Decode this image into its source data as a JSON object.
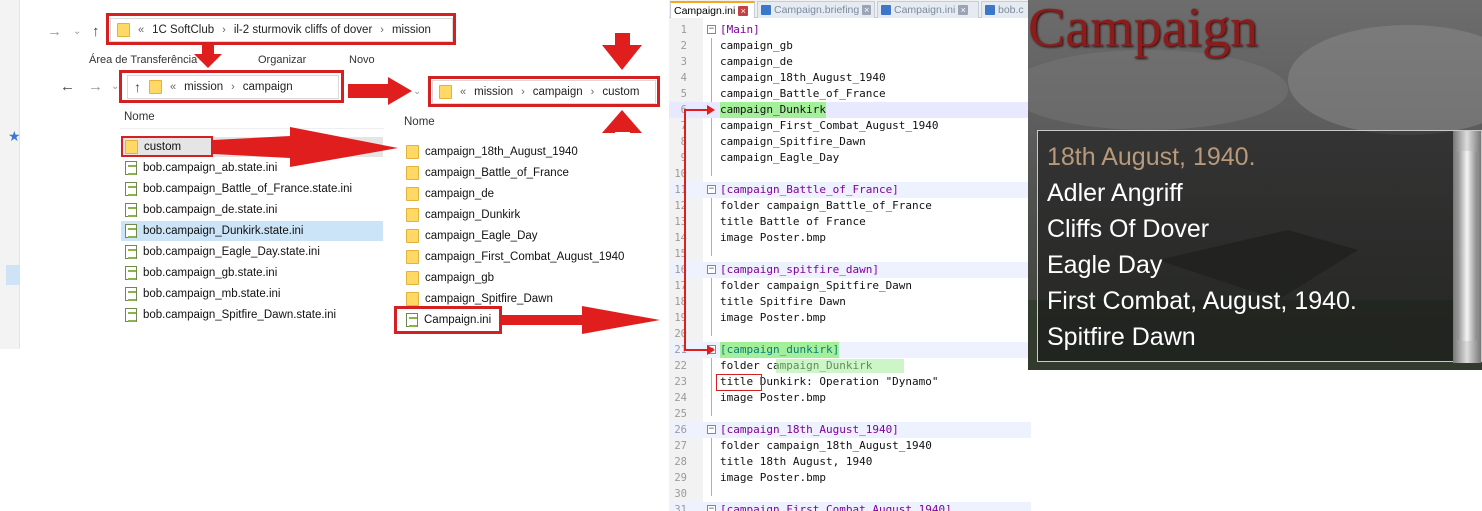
{
  "explorer": {
    "address1": {
      "seg0": "«",
      "seg1": "1C SoftClub",
      "seg2": "il-2 sturmovik cliffs of dover",
      "seg3": "mission"
    },
    "address2": {
      "seg0": "«",
      "seg1": "mission",
      "seg2": "campaign"
    },
    "address3": {
      "seg0": "«",
      "seg1": "mission",
      "seg2": "campaign",
      "seg3": "custom"
    },
    "ribbon": {
      "clipboard": "Área de Transferência",
      "organize": "Organizar",
      "new": "Novo"
    },
    "column_name": "Nome",
    "left_files": [
      "custom",
      "bob.campaign_ab.state.ini",
      "bob.campaign_Battle_of_France.state.ini",
      "bob.campaign_de.state.ini",
      "bob.campaign_Dunkirk.state.ini",
      "bob.campaign_Eagle_Day.state.ini",
      "bob.campaign_gb.state.ini",
      "bob.campaign_mb.state.ini",
      "bob.campaign_Spitfire_Dawn.state.ini"
    ],
    "right_files": [
      "campaign_18th_August_1940",
      "campaign_Battle_of_France",
      "campaign_de",
      "campaign_Dunkirk",
      "campaign_Eagle_Day",
      "campaign_First_Combat_August_1940",
      "campaign_gb",
      "campaign_Spitfire_Dawn",
      "Campaign.ini"
    ]
  },
  "editor": {
    "tabs": [
      "Campaign.ini",
      "Campaign.briefing",
      "Campaign.ini",
      "bob.c"
    ],
    "lines": [
      {
        "n": "1",
        "t": "[Main]"
      },
      {
        "n": "2",
        "t": "campaign_gb"
      },
      {
        "n": "3",
        "t": "campaign_de"
      },
      {
        "n": "4",
        "t": "campaign_18th_August_1940"
      },
      {
        "n": "5",
        "t": "campaign_Battle_of_France"
      },
      {
        "n": "6",
        "t": "campaign_Dunkirk"
      },
      {
        "n": "7",
        "t": "campaign_First_Combat_August_1940"
      },
      {
        "n": "8",
        "t": "campaign_Spitfire_Dawn"
      },
      {
        "n": "9",
        "t": "campaign_Eagle_Day"
      },
      {
        "n": "10",
        "t": ""
      },
      {
        "n": "11",
        "t": "[campaign_Battle_of_France]"
      },
      {
        "n": "12",
        "t": "folder campaign_Battle_of_France"
      },
      {
        "n": "13",
        "t": "title Battle of France"
      },
      {
        "n": "14",
        "t": "image Poster.bmp"
      },
      {
        "n": "15",
        "t": ""
      },
      {
        "n": "16",
        "t": "[campaign_spitfire_dawn]"
      },
      {
        "n": "17",
        "t": "folder campaign_Spitfire_Dawn"
      },
      {
        "n": "18",
        "t": "title Spitfire Dawn"
      },
      {
        "n": "19",
        "t": "image Poster.bmp"
      },
      {
        "n": "20",
        "t": ""
      },
      {
        "n": "21",
        "t": "[campaign_dunkirk]"
      },
      {
        "n": "22",
        "t": "folder campaign_Dunkirk"
      },
      {
        "n": "23",
        "t": "title Dunkirk: Operation \"Dynamo\""
      },
      {
        "n": "24",
        "t": "image Poster.bmp"
      },
      {
        "n": "25",
        "t": ""
      },
      {
        "n": "26",
        "t": "[campaign_18th_August_1940]"
      },
      {
        "n": "27",
        "t": "folder campaign_18th_August_1940"
      },
      {
        "n": "28",
        "t": "title 18th August, 1940"
      },
      {
        "n": "29",
        "t": "image Poster.bmp"
      },
      {
        "n": "30",
        "t": ""
      },
      {
        "n": "31",
        "t": "[campaign_First_Combat_August_1940]"
      }
    ]
  },
  "game": {
    "title": "Campaign",
    "menu": [
      "18th August, 1940.",
      "Adler Angriff",
      "Cliffs Of Dover",
      "Eagle Day",
      "First Combat, August, 1940.",
      "Spitfire Dawn"
    ]
  },
  "colors": {
    "annotation_red": "#d42020",
    "highlight_green": "#a4ef9a",
    "section_purple": "#8000a0",
    "game_title_red": "#8a1c1c"
  }
}
